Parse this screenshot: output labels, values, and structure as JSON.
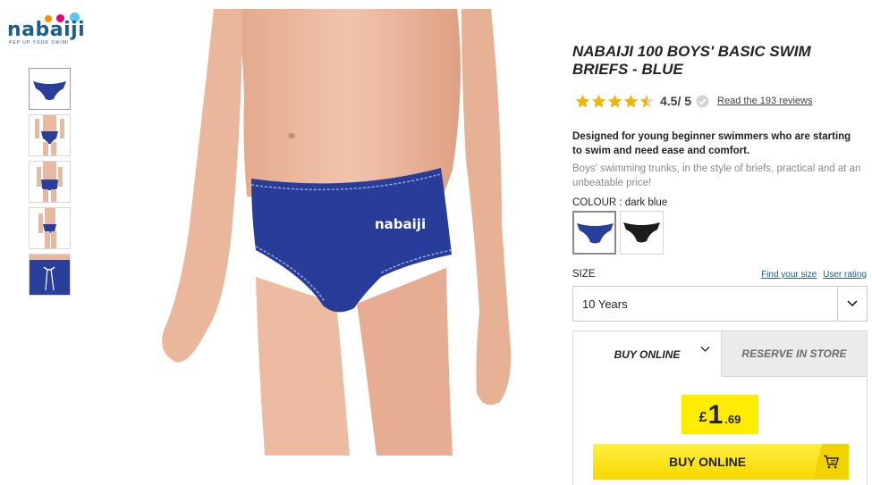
{
  "brand": {
    "name": "nabaiji",
    "tagline": "PEP UP YOUR SWIM!"
  },
  "thumbnails": [
    {
      "name": "front-flat",
      "selected": true
    },
    {
      "name": "worn-front",
      "selected": false
    },
    {
      "name": "worn-back",
      "selected": false
    },
    {
      "name": "worn-side",
      "selected": false
    },
    {
      "name": "drawstring-detail",
      "selected": false
    }
  ],
  "product": {
    "title": "NABAIJI 100 BOYS' BASIC SWIM BRIEFS - BLUE",
    "rating": {
      "value": "4.5",
      "max": "/ 5",
      "stars": 4.5,
      "reviews_link": "Read the 193 reviews"
    },
    "description_strong": "Designed for young beginner swimmers who are starting to swim and need ease and comfort.",
    "description_light": "Boys' swimming trunks, in the style of briefs, practical and at an unbeatable price!",
    "colour": {
      "label": "COLOUR :",
      "selected": "dark blue",
      "options": [
        {
          "name": "dark blue",
          "hex": "#2a3f9c"
        },
        {
          "name": "black",
          "hex": "#1c1c1c"
        }
      ]
    },
    "size": {
      "label": "SIZE",
      "selected": "10 Years",
      "find_link": "Find your size",
      "rating_link": "User rating"
    }
  },
  "buy": {
    "tabs": [
      {
        "label": "BUY ONLINE",
        "active": true
      },
      {
        "label": "RESERVE IN STORE",
        "active": false
      }
    ],
    "price": {
      "currency": "£",
      "units": "1",
      "decimals": ".69"
    },
    "button_label": "BUY ONLINE"
  },
  "colors": {
    "brand_blue": "#1b5f88",
    "price_yellow": "#ffed00",
    "star": "#f5b400"
  }
}
